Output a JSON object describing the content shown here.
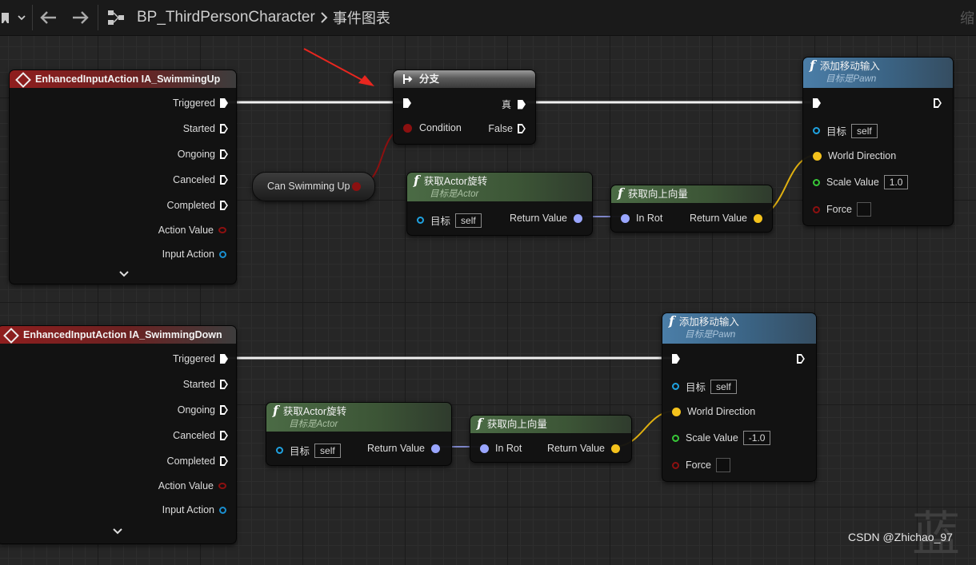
{
  "topbar": {
    "blueprint_name": "BP_ThirdPersonCharacter",
    "graph_name": "事件图表",
    "right_text": "缩"
  },
  "event_up": {
    "title": "EnhancedInputAction IA_SwimmingUp",
    "pins": [
      "Triggered",
      "Started",
      "Ongoing",
      "Canceled",
      "Completed",
      "Action Value",
      "Input Action"
    ]
  },
  "event_down": {
    "title": "EnhancedInputAction IA_SwimmingDown",
    "pins": [
      "Triggered",
      "Started",
      "Ongoing",
      "Canceled",
      "Completed",
      "Action Value",
      "Input Action"
    ]
  },
  "branch": {
    "title": "分支",
    "condition": "Condition",
    "true_label": "真",
    "false_label": "False"
  },
  "can_swim": {
    "label": "Can Swimming Up"
  },
  "get_rot_1": {
    "title": "获取Actor旋转",
    "subtitle": "目标是Actor",
    "target_label": "目标",
    "target_value": "self",
    "return_label": "Return Value"
  },
  "get_up_1": {
    "title": "获取向上向量",
    "in_label": "In Rot",
    "return_label": "Return Value"
  },
  "add_move_1": {
    "title": "添加移动输入",
    "subtitle": "目标是Pawn",
    "target_label": "目标",
    "target_value": "self",
    "world_dir": "World Direction",
    "scale_label": "Scale Value",
    "scale_value": "1.0",
    "force_label": "Force"
  },
  "get_rot_2": {
    "title": "获取Actor旋转",
    "subtitle": "目标是Actor",
    "target_label": "目标",
    "target_value": "self",
    "return_label": "Return Value"
  },
  "get_up_2": {
    "title": "获取向上向量",
    "in_label": "In Rot",
    "return_label": "Return Value"
  },
  "add_move_2": {
    "title": "添加移动输入",
    "subtitle": "目标是Pawn",
    "target_label": "目标",
    "target_value": "self",
    "world_dir": "World Direction",
    "scale_label": "Scale Value",
    "scale_value": "-1.0",
    "force_label": "Force"
  },
  "watermark": {
    "text": "CSDN @Zhichao_97",
    "big_char": "蓝"
  },
  "colors": {
    "exec": "#ffffff",
    "bool": "#8c1010",
    "object": "#1fa2e0",
    "vector": "#f4c21c",
    "rotator": "#9aa6ff",
    "float": "#38c838",
    "struct_blue": "#1a8fd0"
  }
}
